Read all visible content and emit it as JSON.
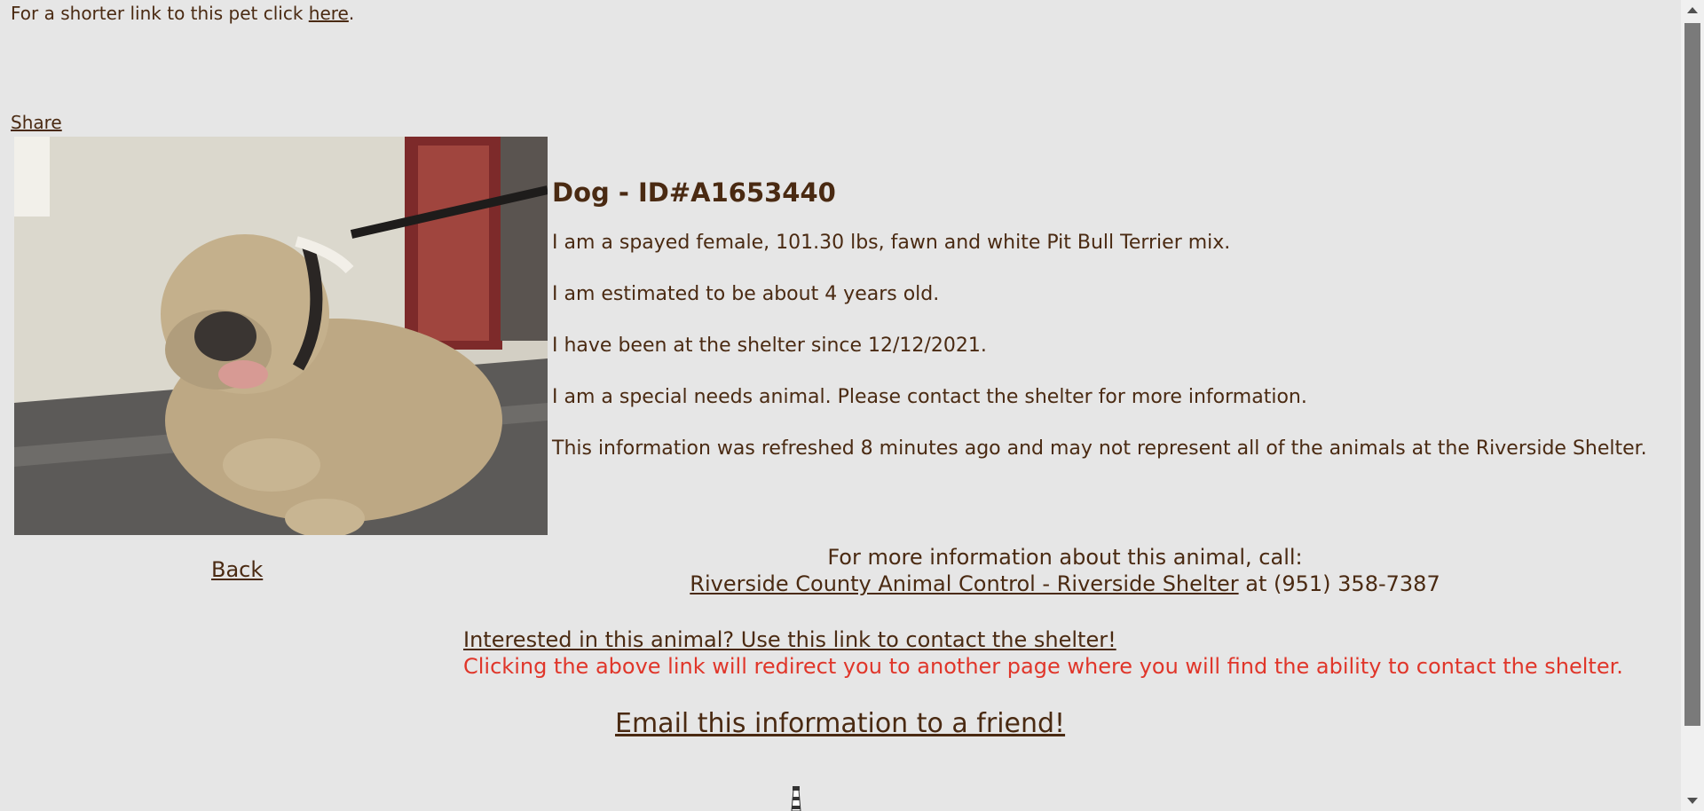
{
  "header": {
    "short_link_text": "For a shorter link to this pet click ",
    "short_link_anchor": "here",
    "short_link_tail": ".",
    "share_label": "Share"
  },
  "animal": {
    "title": "Dog - ID#A1653440",
    "description": "I am a spayed female, 101.30 lbs, fawn and white Pit Bull Terrier mix.",
    "age": "I am estimated to be about 4 years old.",
    "since": "I have been at the shelter since 12/12/2021.",
    "special_needs": "I am a special needs animal. Please contact the shelter for more information.",
    "refresh_note": "This information was refreshed 8 minutes ago and may not represent all of the animals at the Riverside Shelter."
  },
  "nav": {
    "back_label": "Back"
  },
  "contact": {
    "call_intro": "For more information about this animal, call:",
    "shelter_name": "Riverside County Animal Control - Riverside Shelter",
    "phone_text": " at (951) 358-7387",
    "interested_link": "Interested in this animal? Use this link to contact the shelter!",
    "redirect_warning": "Clicking the above link will redirect you to another page where you will find the ability to contact the shelter.",
    "email_link": "Email this information to a friend!"
  },
  "icons": {
    "photo": "dog-photo",
    "footer_logo": "lighthouse-icon"
  },
  "colors": {
    "background": "#e6e6e6",
    "text": "#4a2a12",
    "warning": "#e0362a"
  }
}
